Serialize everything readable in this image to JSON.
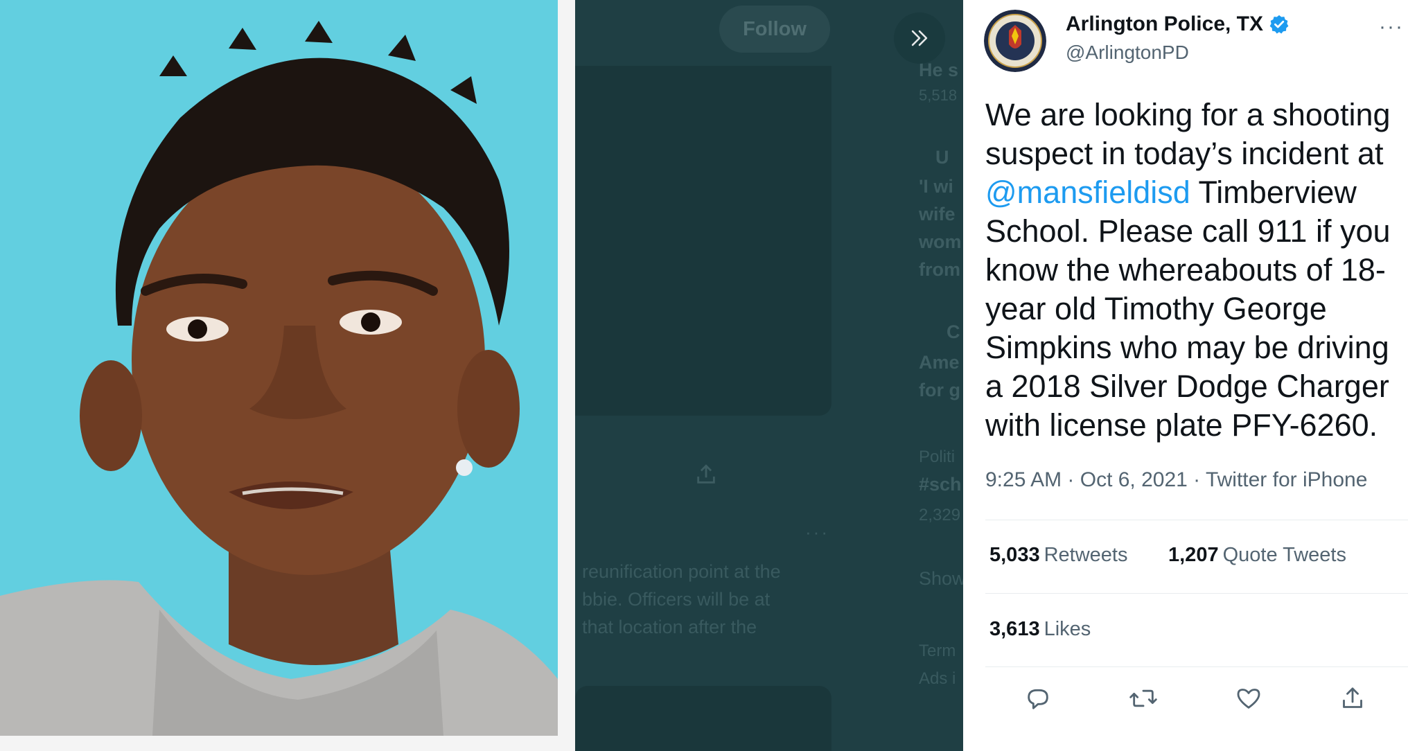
{
  "background": {
    "follow_label": "Follow",
    "ghost_lines": [
      "He s",
      "5,518",
      "U",
      "'I wi",
      "wife",
      "wom",
      "from",
      "C",
      "Ame",
      "for g",
      "Politi",
      "#sch",
      "2,329",
      "Show",
      "Term",
      "Ads i"
    ],
    "ghost_body": [
      "reunification point at the",
      "bbie. Officers will be at",
      "that location after the"
    ]
  },
  "tweet": {
    "author_name": "Arlington Police, TX",
    "author_handle": "@ArlingtonPD",
    "verified": true,
    "body": {
      "part1": "We are looking for a shooting suspect in today’s incident at ",
      "mention": "@mansfieldisd",
      "part2": " Timberview School. Please call 911 if you know the whereabouts of 18-year old Timothy George Simpkins who may be driving a 2018 Silver Dodge Charger with license plate PFY-6260."
    },
    "meta": "9:25 AM · Oct 6, 2021 · Twitter for iPhone",
    "stats": {
      "retweets_count": "5,033",
      "retweets_label": "Retweets",
      "quotes_count": "1,207",
      "quotes_label": "Quote Tweets",
      "likes_count": "3,613",
      "likes_label": "Likes"
    },
    "seal_text": [
      "INTEGRITY",
      "COMPASSION",
      "FAIRNESS",
      "POLICE"
    ]
  },
  "colors": {
    "accent": "#1d9bf0",
    "text": "#0f1419",
    "secondary": "#536471",
    "photo_bg": "#62cfe0",
    "dim_overlay": "#1f3f44"
  },
  "icons": [
    "verified-badge-icon",
    "more-icon",
    "double-chevron-right-icon",
    "reply-icon",
    "retweet-icon",
    "like-icon",
    "share-icon"
  ]
}
